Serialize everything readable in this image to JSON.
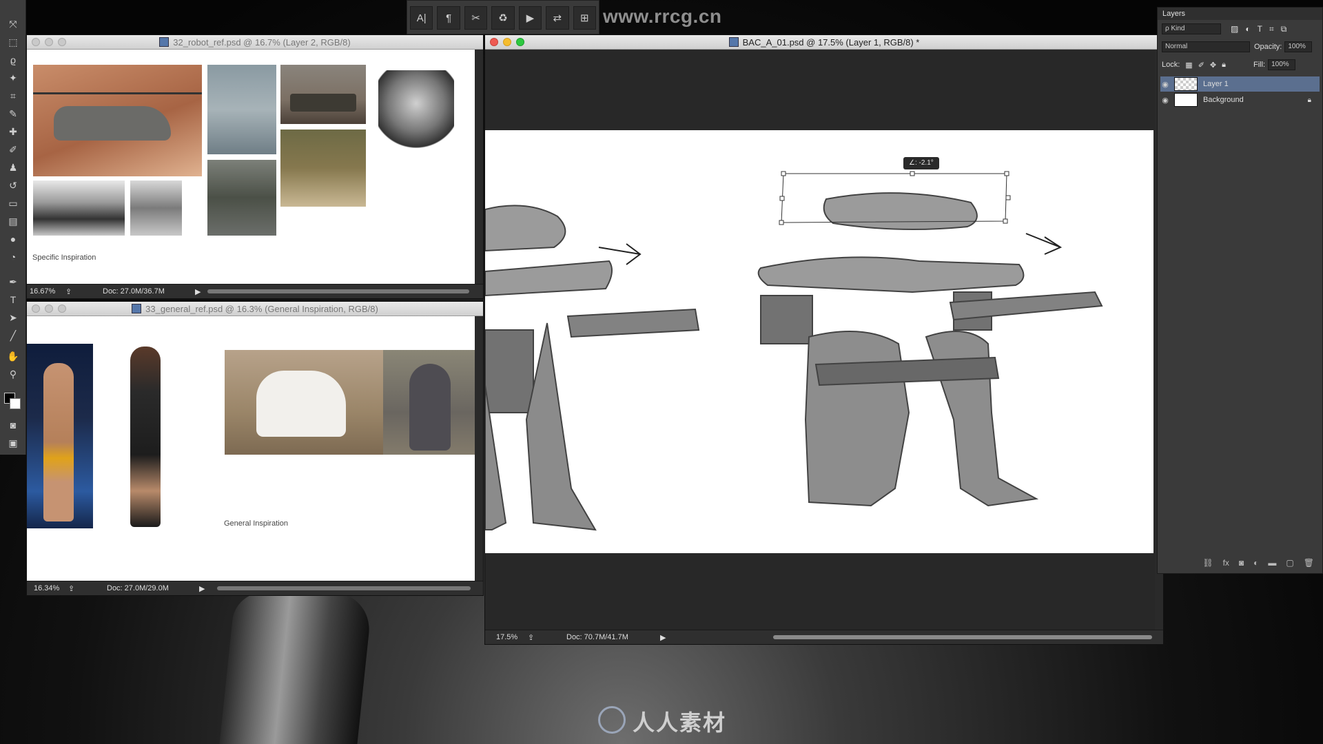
{
  "site_watermark": "www.rrcg.cn",
  "bottom_watermark": "人人素材",
  "toolbar": {
    "tools": [
      "move-icon",
      "marquee-icon",
      "lasso-icon",
      "magic-wand-icon",
      "crop-icon",
      "eyedropper-icon",
      "healing-icon",
      "brush-icon",
      "stamp-icon",
      "history-brush-icon",
      "eraser-icon",
      "gradient-icon",
      "blur-icon",
      "dodge-icon",
      "pen-icon",
      "type-icon",
      "path-select-icon",
      "line-icon",
      "hand-icon",
      "zoom-icon"
    ]
  },
  "optbar": {
    "buttons": [
      "A|",
      "¶",
      "✂",
      "♻",
      "▶",
      "⇄",
      "⊞"
    ]
  },
  "win_robot": {
    "title": "32_robot_ref.psd @ 16.7% (Layer 2, RGB/8)",
    "caption": "Specific Inspiration",
    "zoom": "16.67%",
    "doc": "Doc: 27.0M/36.7M"
  },
  "win_general": {
    "title": "33_general_ref.psd @ 16.3% (General Inspiration, RGB/8)",
    "caption": "General Inspiration",
    "zoom": "16.34%",
    "doc": "Doc: 27.0M/29.0M"
  },
  "win_main": {
    "title": "BAC_A_01.psd @ 17.5% (Layer 1, RGB/8) *",
    "rotate_readout": "∠: -2.1°",
    "zoom": "17.5%",
    "doc": "Doc: 70.7M/41.7M"
  },
  "layers_panel": {
    "title": "Layers",
    "filter": "ρ Kind",
    "blend_mode": "Normal",
    "opacity_label": "Opacity:",
    "opacity_value": "100%",
    "lock_label": "Lock:",
    "fill_label": "Fill:",
    "fill_value": "100%",
    "layers": [
      {
        "name": "Layer 1",
        "selected": true
      },
      {
        "name": "Background",
        "selected": false
      }
    ]
  },
  "colors": {
    "accent_selected_layer": "#5b6f8f",
    "titlebar_close": "#ee5a52",
    "titlebar_min": "#f5bd2f",
    "titlebar_max": "#2dc840"
  }
}
